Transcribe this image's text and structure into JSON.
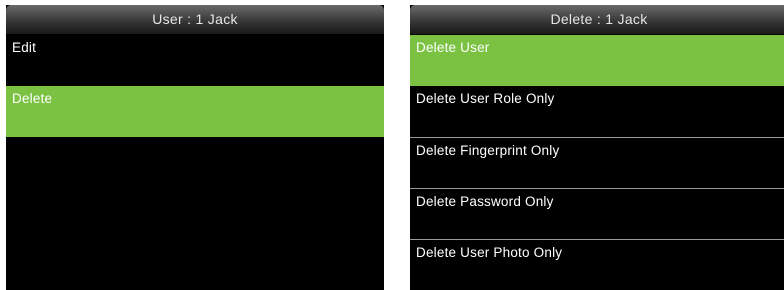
{
  "left_screen": {
    "title": "User : 1 Jack",
    "items": [
      {
        "label": "Edit",
        "selected": false
      },
      {
        "label": "Delete",
        "selected": true
      }
    ]
  },
  "right_screen": {
    "title": "Delete : 1 Jack",
    "items": [
      {
        "label": "Delete User",
        "selected": true
      },
      {
        "label": "Delete User Role Only",
        "selected": false
      },
      {
        "label": "Delete Fingerprint Only",
        "selected": false
      },
      {
        "label": "Delete Password Only",
        "selected": false
      },
      {
        "label": "Delete User Photo Only",
        "selected": false
      }
    ]
  },
  "colors": {
    "selected_background": "#7bc142",
    "screen_background": "#000000",
    "text": "#ffffff",
    "divider": "#9a9a9a"
  }
}
